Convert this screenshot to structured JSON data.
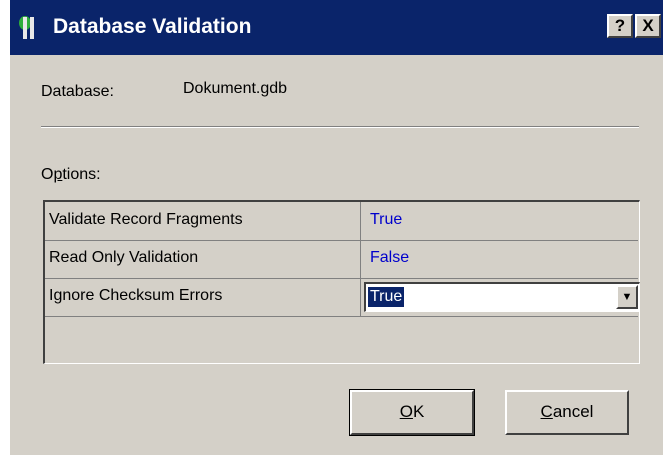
{
  "window": {
    "title": "Database Validation",
    "help_glyph": "?",
    "close_glyph": "X"
  },
  "database": {
    "label": "Database:",
    "value": "Dokument.gdb"
  },
  "options": {
    "label": "Options:",
    "rows": [
      {
        "name": "Validate Record Fragments",
        "value": "True"
      },
      {
        "name": "Read Only Validation",
        "value": "False"
      },
      {
        "name": "Ignore Checksum Errors",
        "value": "True"
      }
    ]
  },
  "buttons": {
    "ok": "OK",
    "cancel": "Cancel"
  },
  "colors": {
    "titlebar": "#0a246a",
    "face": "#d4d0c8",
    "value_text": "#0000cc"
  },
  "icons": {
    "title": "app-icon",
    "combo_arrow": "chevron-down-icon"
  }
}
